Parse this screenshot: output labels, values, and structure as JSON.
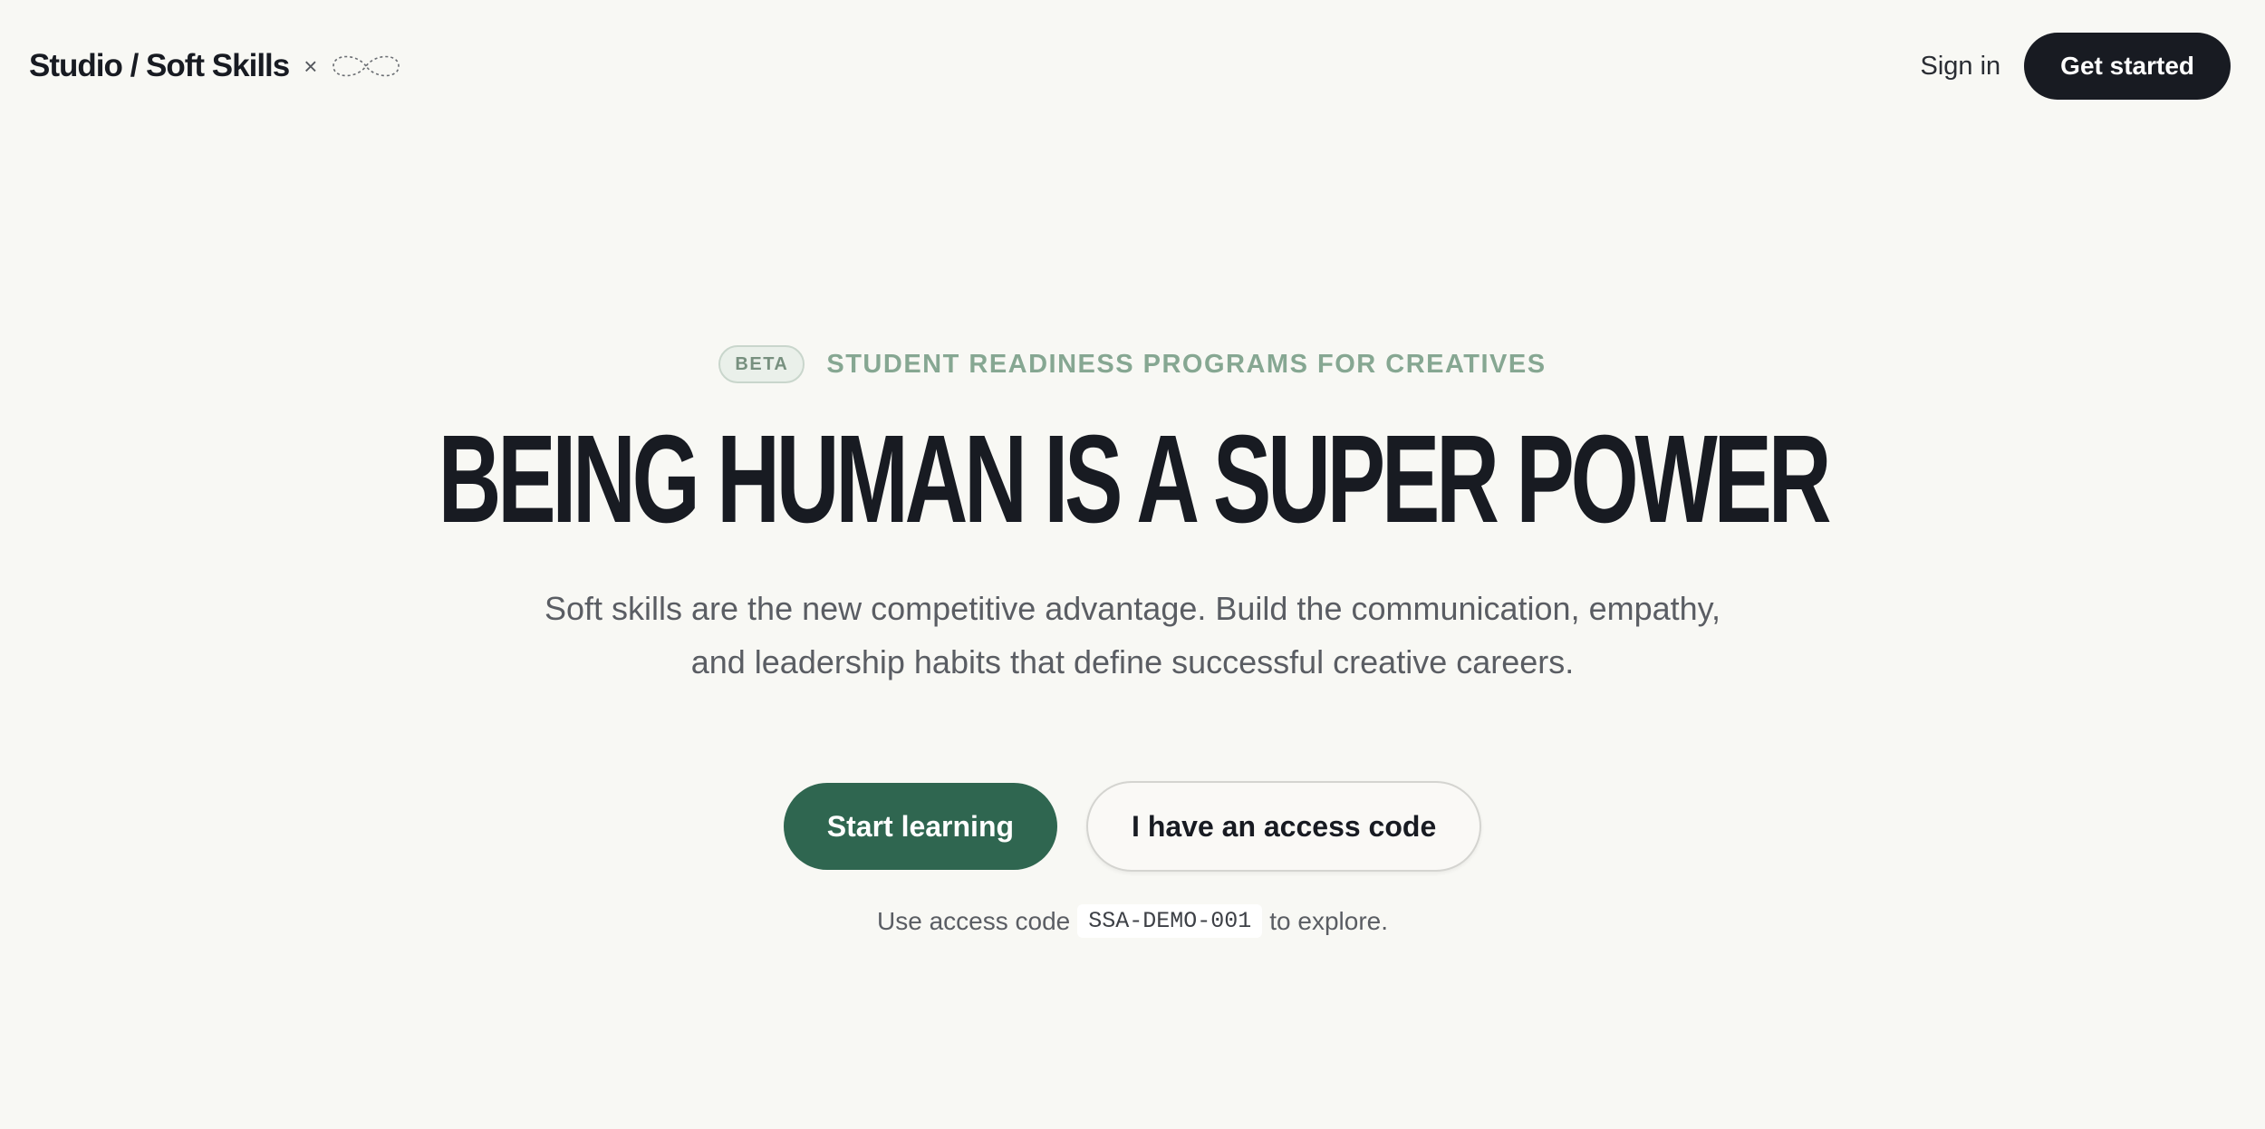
{
  "header": {
    "brand_name": "Studio / Soft Skills",
    "brand_separator": "×",
    "logo_icon": "infinity-icon",
    "signin_label": "Sign in",
    "get_started_label": "Get started"
  },
  "hero": {
    "badge": "BETA",
    "eyebrow": "STUDENT READINESS PROGRAMS FOR CREATIVES",
    "headline": "BEING HUMAN IS A SUPER POWER",
    "subtitle": "Soft skills are the new competitive advantage. Build the communication, empathy, and leadership habits that define successful creative careers.",
    "primary_cta": "Start learning",
    "secondary_cta": "I have an access code",
    "hint_prefix": "Use access code",
    "hint_code": "SSA-DEMO-001",
    "hint_suffix": "to explore."
  },
  "colors": {
    "background": "#f8f8f4",
    "ink": "#181b22",
    "accent_green": "#2f6650",
    "eyebrow_green": "#86a792"
  }
}
